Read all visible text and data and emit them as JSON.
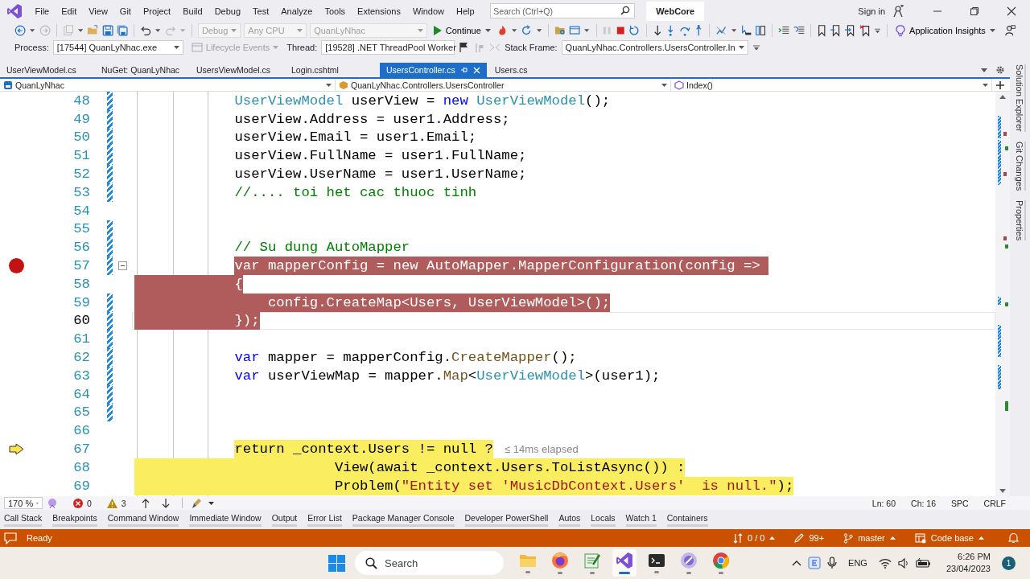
{
  "menu_bar": {
    "items": [
      "File",
      "Edit",
      "View",
      "Git",
      "Project",
      "Build",
      "Debug",
      "Test",
      "Analyze",
      "Tools",
      "Extensions",
      "Window",
      "Help"
    ],
    "search": {
      "placeholder": "Search (Ctrl+Q)"
    },
    "solution_name": "WebCore",
    "sign_in": "Sign in"
  },
  "toolbar": {
    "configuration": {
      "text": "Debug",
      "disabled": true
    },
    "platform": {
      "text": "Any CPU",
      "disabled": true
    },
    "startup_project": {
      "text": "QuanLyNhac",
      "disabled": true
    },
    "continue": "Continue",
    "application_insights": "Application Insights"
  },
  "debug_location": {
    "process_label": "Process:",
    "process": "[17544] QuanLyNhac.exe",
    "lifecycle_events": {
      "text": "Lifecycle Events",
      "disabled": true
    },
    "thread_label": "Thread:",
    "thread": "[19528] .NET ThreadPool Worker",
    "stack_frame_label": "Stack Frame:",
    "stack_frame": "QuanLyNhac.Controllers.UsersController.In"
  },
  "tabs": [
    {
      "label": "UserViewModel.cs",
      "selected": false
    },
    {
      "label": "NuGet: QuanLyNhac",
      "selected": false
    },
    {
      "label": "UsersViewModel.cs",
      "selected": false
    },
    {
      "label": "Login.cshtml",
      "selected": false
    },
    {
      "label": "UsersController.cs",
      "selected": true
    },
    {
      "label": "Users.cs",
      "selected": false
    }
  ],
  "nav_bar": {
    "project": "QuanLyNhac",
    "type": "QuanLyNhac.Controllers.UsersController",
    "member": "Index()"
  },
  "code_lines": [
    {
      "number": "48",
      "kind": "plain",
      "changed": true,
      "caret": false,
      "tokens": [
        {
          "text": "            UserViewModel",
          "kind": "type"
        },
        {
          "text": " userView = ",
          "kind": "plain"
        },
        {
          "text": "new",
          "kind": "keyword"
        },
        {
          "text": " UserViewModel",
          "kind": "type"
        },
        {
          "text": "();",
          "kind": "plain"
        }
      ]
    },
    {
      "number": "49",
      "kind": "plain",
      "changed": true,
      "caret": false,
      "tokens": [
        {
          "text": "            userView.Address = user1.Address;",
          "kind": "plain"
        }
      ]
    },
    {
      "number": "50",
      "kind": "plain",
      "changed": true,
      "caret": false,
      "tokens": [
        {
          "text": "            userView.Email = user1.Email;",
          "kind": "plain"
        }
      ]
    },
    {
      "number": "51",
      "kind": "plain",
      "changed": true,
      "caret": false,
      "tokens": [
        {
          "text": "            userView.FullName = user1.FullName;",
          "kind": "plain"
        }
      ]
    },
    {
      "number": "52",
      "kind": "plain",
      "changed": true,
      "caret": false,
      "tokens": [
        {
          "text": "            userView.UserName = user1.UserName;",
          "kind": "plain"
        }
      ]
    },
    {
      "number": "53",
      "kind": "plain",
      "changed": true,
      "caret": false,
      "tokens": [
        {
          "text": "            //.... toi het cac thuoc tinh",
          "kind": "comment"
        }
      ]
    },
    {
      "number": "54",
      "kind": "plain",
      "changed": false,
      "caret": false
    },
    {
      "number": "55",
      "kind": "plain",
      "changed": true,
      "caret": false
    },
    {
      "number": "56",
      "kind": "plain",
      "changed": true,
      "caret": false,
      "tokens": [
        {
          "text": "            // Su dung AutoMapper",
          "kind": "comment"
        }
      ]
    },
    {
      "number": "57",
      "kind": "breakpoint-start",
      "changed": true,
      "caret": false,
      "collapsed": false,
      "tokens": [
        {
          "text": "            var",
          "kind": "keyword"
        },
        {
          "text": " mapperConfig = ",
          "kind": "plain"
        },
        {
          "text": "new",
          "kind": "keyword"
        },
        {
          "text": " AutoMapper.",
          "kind": "plain"
        },
        {
          "text": "MapperConfiguration",
          "kind": "type"
        },
        {
          "text": "(config => ",
          "kind": "plain"
        }
      ]
    },
    {
      "number": "58",
      "kind": "breakpoint",
      "changed": false,
      "caret": false,
      "tokens": [
        {
          "text": "            {",
          "kind": "plain"
        }
      ]
    },
    {
      "number": "59",
      "kind": "breakpoint",
      "changed": true,
      "caret": false,
      "tokens": [
        {
          "text": "                config.CreateMap<",
          "kind": "plain"
        },
        {
          "text": "Users",
          "kind": "type"
        },
        {
          "text": ", ",
          "kind": "plain"
        },
        {
          "text": "UserViewModel",
          "kind": "type"
        },
        {
          "text": ">();",
          "kind": "plain"
        }
      ]
    },
    {
      "number": "60",
      "kind": "breakpoint",
      "changed": true,
      "caret": true,
      "tokens": [
        {
          "text": "            });",
          "kind": "plain"
        }
      ]
    },
    {
      "number": "61",
      "kind": "plain",
      "changed": true,
      "caret": false
    },
    {
      "number": "62",
      "kind": "plain",
      "changed": true,
      "caret": false,
      "tokens": [
        {
          "text": "            var",
          "kind": "keyword"
        },
        {
          "text": " mapper = mapperConfig.",
          "kind": "plain"
        },
        {
          "text": "CreateMapper",
          "kind": "method"
        },
        {
          "text": "();",
          "kind": "plain"
        }
      ]
    },
    {
      "number": "63",
      "kind": "plain",
      "changed": true,
      "caret": false,
      "tokens": [
        {
          "text": "            var",
          "kind": "keyword"
        },
        {
          "text": " userViewMap = mapper.",
          "kind": "plain"
        },
        {
          "text": "Map",
          "kind": "method"
        },
        {
          "text": "<",
          "kind": "plain"
        },
        {
          "text": "UserViewModel",
          "kind": "type"
        },
        {
          "text": ">(user1);",
          "kind": "plain"
        }
      ]
    },
    {
      "number": "64",
      "kind": "plain",
      "changed": true,
      "caret": false
    },
    {
      "number": "65",
      "kind": "plain",
      "changed": true,
      "caret": false
    },
    {
      "number": "66",
      "kind": "plain",
      "changed": false,
      "caret": false
    },
    {
      "number": "67",
      "kind": "current-start",
      "changed": false,
      "caret": false,
      "tokens": [
        {
          "text": "            return",
          "kind": "keyword"
        },
        {
          "text": " _context.Users != ",
          "kind": "plain"
        },
        {
          "text": "null",
          "kind": "keyword"
        },
        {
          "text": " ?",
          "kind": "plain"
        }
      ],
      "hint": "≤ 14ms elapsed"
    },
    {
      "number": "68",
      "kind": "current",
      "changed": false,
      "caret": false,
      "tokens": [
        {
          "text": "                        View(",
          "kind": "plain"
        },
        {
          "text": "await",
          "kind": "keyword"
        },
        {
          "text": " _context.Users.ToListAsync()) :",
          "kind": "plain"
        }
      ]
    },
    {
      "number": "69",
      "kind": "current",
      "changed": false,
      "caret": false,
      "tokens": [
        {
          "text": "                        Problem(",
          "kind": "plain"
        },
        {
          "text": "\"Entity set 'MusicDbContext.Users'  is null.\"",
          "kind": "string"
        },
        {
          "text": ");",
          "kind": "plain"
        }
      ]
    }
  ],
  "side_tabs": [
    "Solution Explorer",
    "Git Changes",
    "Properties"
  ],
  "editor_status": {
    "zoom": "170 %",
    "errors": "0",
    "warnings": "3",
    "line": "Ln: 60",
    "column": "Ch: 16",
    "indentation": "SPC",
    "line_ending": "CRLF"
  },
  "tool_tabs": [
    "Call Stack",
    "Breakpoints",
    "Command Window",
    "Immediate Window",
    "Output",
    "Error List",
    "Package Manager Console",
    "Developer PowerShell",
    "Autos",
    "Locals",
    "Watch 1",
    "Containers"
  ],
  "status_bar": {
    "message": "Ready",
    "changes": "0 / 0",
    "edits": "99+",
    "branch": "master",
    "repository": "Code base"
  },
  "taskbar": {
    "search_placeholder": "Search",
    "apps": [
      {
        "kind": "folder",
        "selected": false
      },
      {
        "kind": "firefox",
        "selected": false
      },
      {
        "kind": "editor",
        "selected": false
      },
      {
        "kind": "visual-studio",
        "selected": true
      },
      {
        "kind": "terminal",
        "selected": false
      },
      {
        "kind": "tool",
        "selected": false
      },
      {
        "kind": "chrome",
        "selected": false
      }
    ],
    "language": "ENG",
    "time": "6:26 PM",
    "date": "23/04/2023",
    "notifications": "1"
  }
}
